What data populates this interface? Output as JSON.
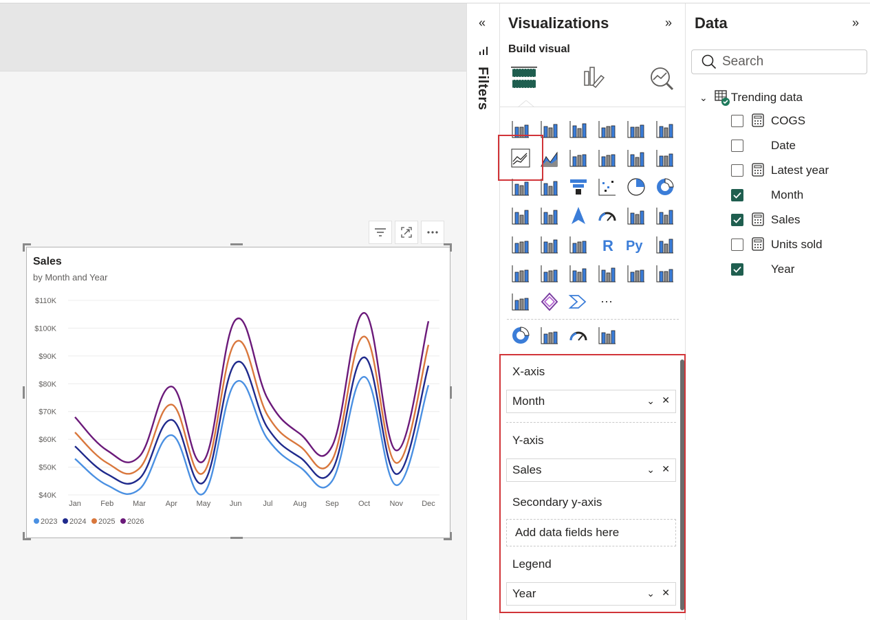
{
  "chart": {
    "title": "Sales",
    "subtitle": "by Month and Year"
  },
  "chart_data": {
    "type": "line",
    "title": "Sales",
    "subtitle": "by Month and Year",
    "categories": [
      "Jan",
      "Feb",
      "Mar",
      "Apr",
      "May",
      "Jun",
      "Jul",
      "Aug",
      "Sep",
      "Oct",
      "Nov",
      "Dec"
    ],
    "ylim": [
      40000,
      110000
    ],
    "yticks": [
      "$40K",
      "$50K",
      "$60K",
      "$70K",
      "$80K",
      "$90K",
      "$100K",
      "$110K"
    ],
    "yticks_values": [
      40000,
      50000,
      60000,
      70000,
      80000,
      90000,
      100000,
      110000
    ],
    "grid": true,
    "legend": "bottom-left",
    "series": [
      {
        "name": "2023",
        "color": "#4a90e2",
        "values": [
          53000,
          43500,
          42000,
          61500,
          40500,
          80500,
          60000,
          50000,
          45000,
          82500,
          43500,
          79500
        ]
      },
      {
        "name": "2024",
        "color": "#1f2a8c",
        "values": [
          57500,
          47500,
          45800,
          67000,
          44500,
          87500,
          64000,
          53500,
          48800,
          89500,
          47500,
          86500
        ]
      },
      {
        "name": "2025",
        "color": "#d9773c",
        "values": [
          62500,
          51500,
          49500,
          72500,
          48000,
          95000,
          68500,
          57500,
          52500,
          97000,
          51500,
          94000
        ]
      },
      {
        "name": "2026",
        "color": "#6b1a7a",
        "values": [
          68000,
          56000,
          53800,
          79000,
          52200,
          103000,
          74500,
          62000,
          57500,
          105500,
          56000,
          102500
        ]
      }
    ]
  },
  "filters": {
    "label": "Filters"
  },
  "visualizations": {
    "title": "Visualizations",
    "build_visual": "Build visual",
    "wells": {
      "xaxis_label": "X-axis",
      "xaxis_value": "Month",
      "yaxis_label": "Y-axis",
      "yaxis_value": "Sales",
      "secondary_label": "Secondary y-axis",
      "secondary_placeholder": "Add data fields here",
      "legend_label": "Legend",
      "legend_value": "Year"
    },
    "more_label": "···"
  },
  "data": {
    "title": "Data",
    "search_placeholder": "Search",
    "table_name": "Trending data",
    "fields": [
      {
        "name": "COGS",
        "checked": false,
        "calc": true
      },
      {
        "name": "Date",
        "checked": false,
        "calc": false
      },
      {
        "name": "Latest year",
        "checked": false,
        "calc": true
      },
      {
        "name": "Month",
        "checked": true,
        "calc": false
      },
      {
        "name": "Sales",
        "checked": true,
        "calc": true
      },
      {
        "name": "Units sold",
        "checked": false,
        "calc": true
      },
      {
        "name": "Year",
        "checked": true,
        "calc": false
      }
    ]
  }
}
